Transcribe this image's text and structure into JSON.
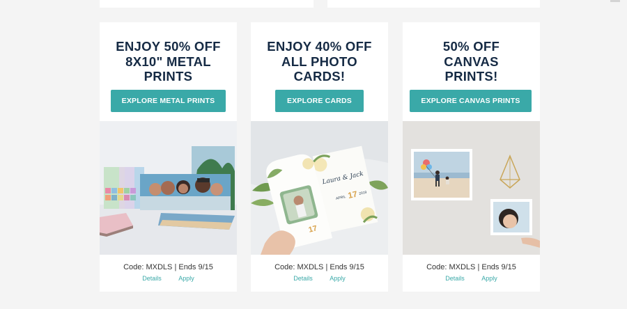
{
  "cards": [
    {
      "title": "ENJOY 50% OFF\n8X10\" METAL\nPRINTS",
      "button": "EXPLORE METAL PRINTS",
      "code_line": "Code: MXDLS | Ends 9/15",
      "details": "Details",
      "apply": "Apply"
    },
    {
      "title": "ENJOY 40% OFF\nALL PHOTO\nCARDS!",
      "button": "EXPLORE CARDS",
      "code_line": "Code: MXDLS | Ends 9/15",
      "details": "Details",
      "apply": "Apply",
      "card_script_names": "Laura & Jack",
      "card_date": "17",
      "card_month": "APRIL",
      "card_year": "2019"
    },
    {
      "title": "50% OFF\nCANVAS\nPRINTS!",
      "button": "EXPLORE CANVAS PRINTS",
      "code_line": "Code: MXDLS | Ends 9/15",
      "details": "Details",
      "apply": "Apply"
    }
  ],
  "colors": {
    "page_background": "#f4f4f4",
    "card_background": "#ffffff",
    "title_text": "#152a44",
    "button_background": "#3aa9a8",
    "button_text": "#ffffff",
    "link": "#3aa9a8"
  }
}
